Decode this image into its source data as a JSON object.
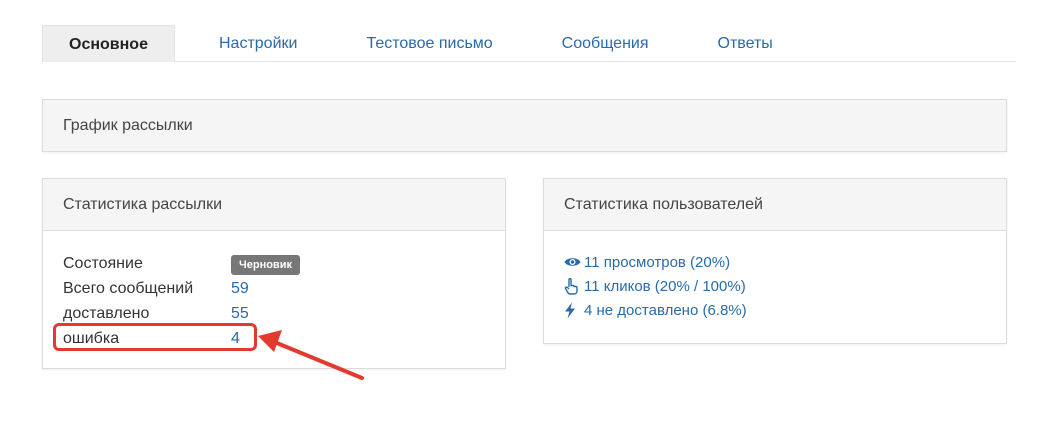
{
  "tabs": [
    {
      "label": "Основное",
      "active": true
    },
    {
      "label": "Настройки"
    },
    {
      "label": "Тестовое письмо"
    },
    {
      "label": "Сообщения"
    },
    {
      "label": "Ответы"
    }
  ],
  "schedule_panel": {
    "title": "График рассылки"
  },
  "stats_panel": {
    "title": "Статистика рассылки",
    "rows": [
      {
        "label": "Состояние",
        "value": "Черновик"
      },
      {
        "label": "Всего сообщений",
        "value": "59"
      },
      {
        "label": "доставлено",
        "value": "55"
      },
      {
        "label": "ошибка",
        "value": "4"
      }
    ]
  },
  "users_panel": {
    "title": "Статистика пользователей",
    "links": [
      {
        "icon": "eye-icon",
        "text": "11 просмотров (20%)"
      },
      {
        "icon": "pointer-hand-icon",
        "text": "11 кликов (20% / 100%)"
      },
      {
        "icon": "lightning-icon",
        "text": "4 не доставлено (6.8%)"
      }
    ]
  },
  "colors": {
    "accent": "#2a6aa8",
    "highlight": "#e23a2e",
    "badge": "#777777"
  }
}
